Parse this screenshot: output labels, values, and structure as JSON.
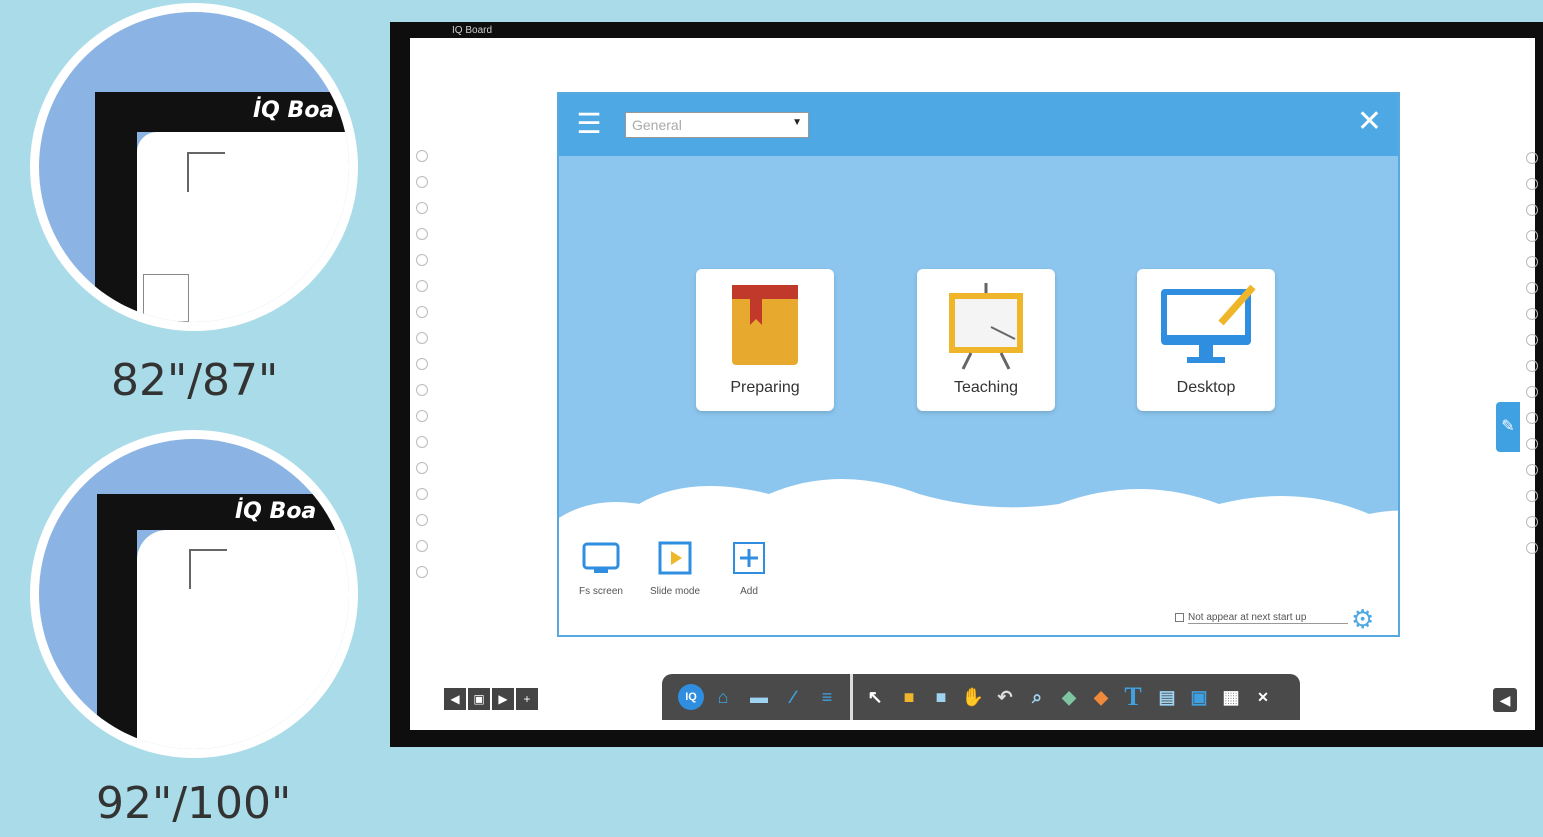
{
  "zooms": [
    {
      "brand": "İQ Boa",
      "size_label": "82\"/87\""
    },
    {
      "brand": "İQ Boa",
      "size_label": "92\"/100\""
    }
  ],
  "window": {
    "title": "IQ Board"
  },
  "dialog": {
    "select_value": "General",
    "close_label": "✕",
    "cards": [
      {
        "label": "Preparing",
        "icon": "book-icon"
      },
      {
        "label": "Teaching",
        "icon": "easel-icon"
      },
      {
        "label": "Desktop",
        "icon": "monitor-pen-icon"
      }
    ],
    "bottom_items": [
      {
        "label": "Fs screen"
      },
      {
        "label": "Slide mode"
      },
      {
        "label": "Add"
      }
    ],
    "checkbox_label": "Not appear at next start up",
    "gear_icon": "⚙"
  },
  "toolbar": {
    "buttons": [
      "IQ",
      "⌂",
      "▬",
      "∕",
      "≡",
      "↖",
      "■",
      "■",
      "✋",
      "↶",
      "⌕",
      "◆",
      "◆",
      "T",
      "▤",
      "▣",
      "▦",
      "✕"
    ]
  },
  "page_nav": [
    "◀",
    "▣",
    "▶",
    "+"
  ],
  "corner_btn": "◀",
  "side_tab": "✎",
  "colors": {
    "accent": "#4ea8e3",
    "background": "#a9dbe8",
    "bezel": "#0e0e0e"
  }
}
